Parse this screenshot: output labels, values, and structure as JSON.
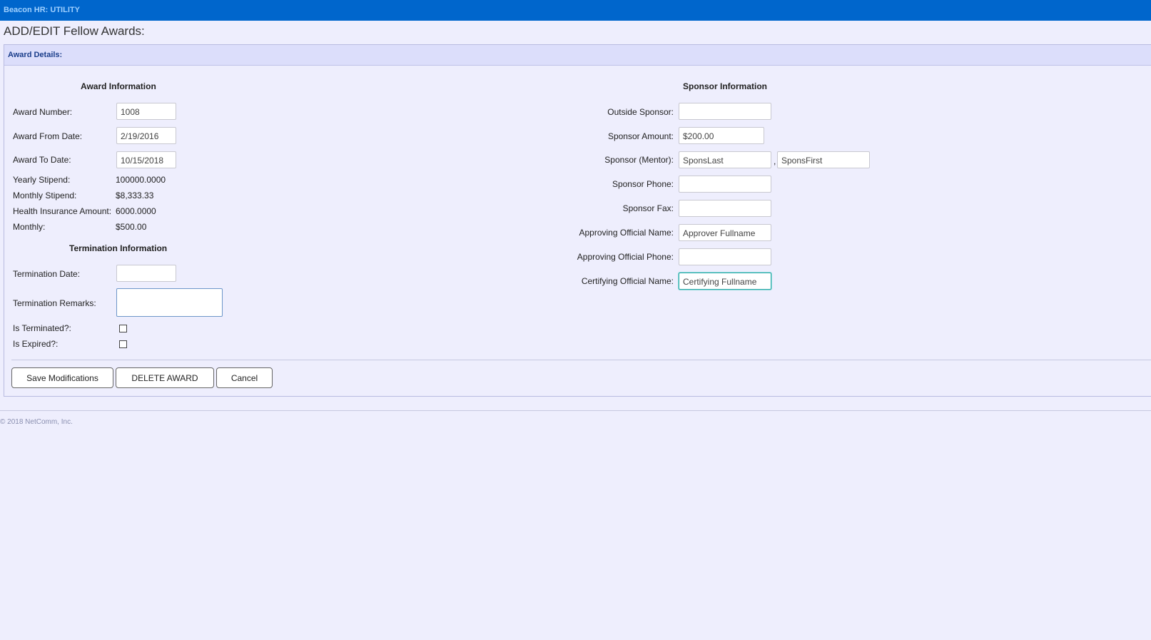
{
  "app": {
    "title": "Beacon HR: UTILITY"
  },
  "page": {
    "title": "ADD/EDIT Fellow Awards:"
  },
  "panel": {
    "header": "Award Details:"
  },
  "award_info": {
    "title": "Award Information",
    "award_number_label": "Award Number:",
    "award_number_value": "1008",
    "from_date_label": "Award From Date:",
    "from_date_value": "2/19/2016",
    "to_date_label": "Award To Date:",
    "to_date_value": "10/15/2018",
    "yearly_stipend_label": "Yearly Stipend:",
    "yearly_stipend_value": "100000.0000",
    "monthly_stipend_label": "Monthly Stipend:",
    "monthly_stipend_value": "$8,333.33",
    "health_insurance_label": "Health Insurance Amount:",
    "health_insurance_value": "6000.0000",
    "monthly_label": "Monthly:",
    "monthly_value": "$500.00"
  },
  "termination_info": {
    "title": "Termination Information",
    "date_label": "Termination Date:",
    "date_value": "",
    "remarks_label": "Termination Remarks:",
    "remarks_value": "",
    "is_terminated_label": "Is Terminated?:",
    "is_terminated_checked": false,
    "is_expired_label": "Is Expired?:",
    "is_expired_checked": false
  },
  "sponsor_info": {
    "title": "Sponsor Information",
    "outside_sponsor_label": "Outside Sponsor:",
    "outside_sponsor_value": "",
    "sponsor_amount_label": "Sponsor Amount:",
    "sponsor_amount_value": "$200.00",
    "mentor_label": "Sponsor (Mentor):",
    "mentor_last_value": "SponsLast",
    "mentor_separator": ",",
    "mentor_first_value": "SponsFirst",
    "phone_label": "Sponsor Phone:",
    "phone_value": "",
    "fax_label": "Sponsor Fax:",
    "fax_value": "",
    "approving_name_label": "Approving Official Name:",
    "approving_name_value": "Approver Fullname",
    "approving_phone_label": "Approving Official Phone:",
    "approving_phone_value": "",
    "certifying_name_label": "Certifying Official Name:",
    "certifying_name_value": "Certifying Fullname"
  },
  "buttons": {
    "save": "Save Modifications",
    "delete": "DELETE AWARD",
    "cancel": "Cancel"
  },
  "footer": {
    "copyright": "© 2018 NetComm, Inc."
  }
}
